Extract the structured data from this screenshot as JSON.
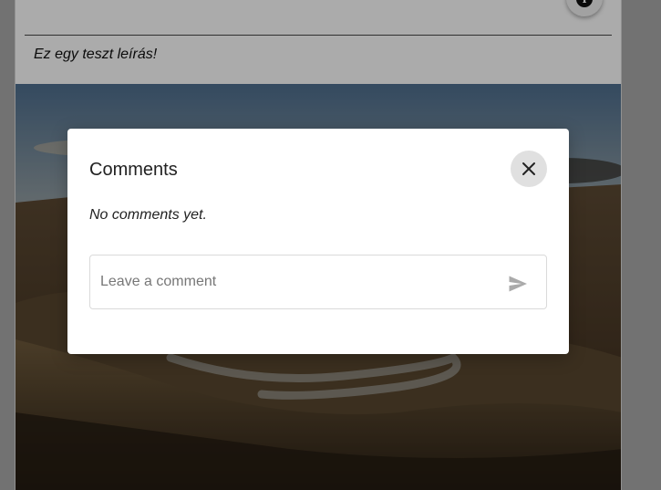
{
  "post": {
    "description": "Ez egy teszt leírás!",
    "info_icon": "info-icon",
    "image": "landscape-photo-winding-road"
  },
  "dialog": {
    "title": "Comments",
    "empty_message": "No comments yet.",
    "close_icon": "close-icon",
    "comment_input": {
      "placeholder": "Leave a comment",
      "value": ""
    },
    "send_icon": "send-icon"
  },
  "colors": {
    "overlay": "rgba(0,0,0,0.33)",
    "dialog_bg": "#ffffff",
    "close_button_bg": "#e0e0e0",
    "send_icon": "#aaaaaa"
  }
}
